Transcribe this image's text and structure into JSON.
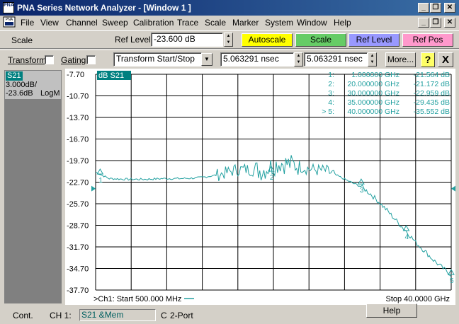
{
  "window": {
    "title": "PNA Series Network Analyzer - [Window 1 ]",
    "app_icon_text": "PNA"
  },
  "menu": [
    "File",
    "View",
    "Channel",
    "Sweep",
    "Calibration",
    "Trace",
    "Scale",
    "Marker",
    "System",
    "Window",
    "Help"
  ],
  "toolbar1": {
    "scale_label": "Scale",
    "ref_level_label": "Ref Level",
    "ref_level_value": "-23.600 dB",
    "buttons": [
      {
        "label": "Autoscale",
        "color": "#ffff00"
      },
      {
        "label": "Scale",
        "color": "#66cc66"
      },
      {
        "label": "Ref Level",
        "color": "#9999ff"
      },
      {
        "label": "Ref Pos",
        "color": "#ff99cc"
      }
    ]
  },
  "toolbar2": {
    "transform_label": "Transform",
    "gating_label": "Gating",
    "transform_select": "Transform Start/Stop",
    "start_value": "5.063291 nsec",
    "stop_value": "5.063291 nsec",
    "more_label": "More...",
    "help_icon": "?",
    "close_icon": "X"
  },
  "trace_panel": {
    "name": "S21",
    "scale": "3.000dB/",
    "ref": "-23.6dB",
    "format": "LogM"
  },
  "plot": {
    "trace_label": "dB S21",
    "y_ticks": [
      "-7.70",
      "-10.70",
      "-13.70",
      "-16.70",
      "-19.70",
      "-22.70",
      "-25.70",
      "-28.70",
      "-31.70",
      "-34.70",
      "-37.70"
    ],
    "start_label": ">Ch1: Start  500.000 MHz",
    "stop_label": "Stop  40.0000 GHz",
    "trace_color": "#22a0a0",
    "markers": [
      {
        "id": "1:",
        "freq": "1.000000 GHz",
        "value": "-21.564 dB"
      },
      {
        "id": "2:",
        "freq": "20.000000 GHz",
        "value": "-21.172 dB"
      },
      {
        "id": "3:",
        "freq": "30.000000 GHz",
        "value": "-22.959 dB"
      },
      {
        "id": "4:",
        "freq": "35.000000 GHz",
        "value": "-29.435 dB"
      },
      {
        "id": "> 5:",
        "freq": "40.000000 GHz",
        "value": "-35.552 dB"
      }
    ],
    "marker_labels": [
      "1",
      "2",
      "3",
      "4",
      "5"
    ]
  },
  "chart_data": {
    "type": "line",
    "xlabel": "",
    "ylabel": "",
    "xlim": [
      0.5,
      40.0
    ],
    "ylim": [
      -37.7,
      -7.7
    ],
    "grid": true,
    "x": [
      0.5,
      1,
      2,
      4,
      6,
      8,
      10,
      12,
      14,
      15,
      16,
      17,
      18,
      19,
      20,
      21,
      22,
      23,
      24,
      25,
      26,
      27,
      28,
      29,
      30,
      31,
      32,
      33,
      34,
      35,
      36,
      37,
      38,
      39,
      40
    ],
    "y": [
      -21.3,
      -21.6,
      -22.2,
      -22.3,
      -22.3,
      -22.2,
      -22.2,
      -22.1,
      -21.7,
      -21.4,
      -21.0,
      -20.9,
      -21.0,
      -21.1,
      -20.5,
      -20.0,
      -20.2,
      -20.4,
      -20.8,
      -21.0,
      -21.1,
      -21.6,
      -22.2,
      -22.8,
      -23.3,
      -24.3,
      -25.5,
      -26.8,
      -28.2,
      -29.5,
      -31.0,
      -32.2,
      -33.5,
      -34.6,
      -35.6
    ],
    "markers": [
      {
        "name": "1",
        "x": 1,
        "y": -21.564
      },
      {
        "name": "2",
        "x": 20,
        "y": -21.172
      },
      {
        "name": "3",
        "x": 30,
        "y": -22.959
      },
      {
        "name": "4",
        "x": 35,
        "y": -29.435
      },
      {
        "name": "5",
        "x": 40,
        "y": -35.552
      }
    ]
  },
  "statusbar": {
    "mode": "Cont.",
    "channel": "CH 1:",
    "trace": "S21 &Mem",
    "cal": "C",
    "port": "2-Port",
    "help": "Help"
  }
}
